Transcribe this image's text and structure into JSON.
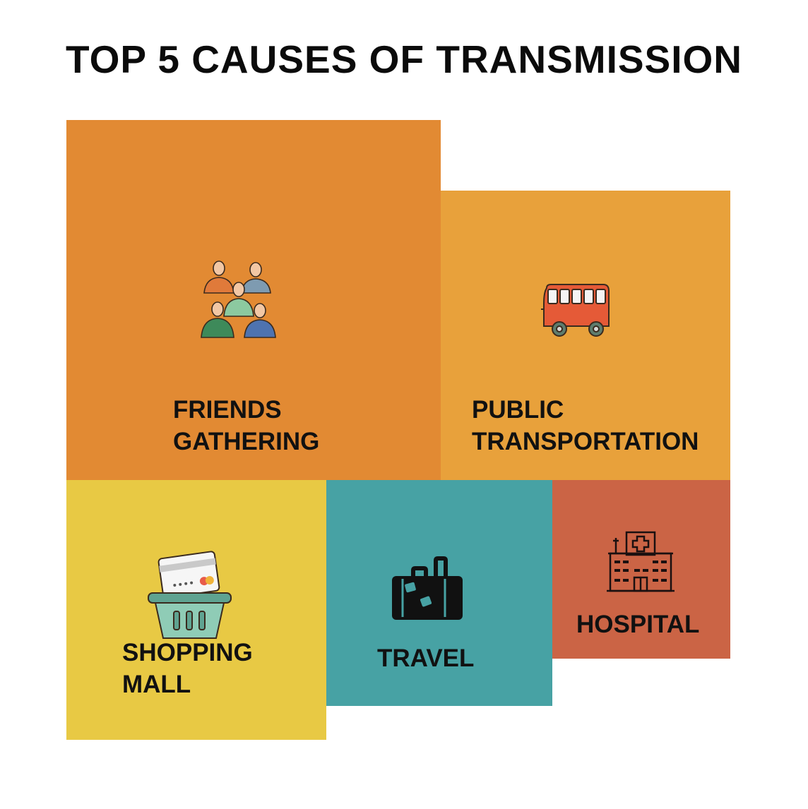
{
  "title": "TOP 5 CAUSES OF TRANSMISSION",
  "tiles": [
    {
      "id": "friends-gathering",
      "label_lines": [
        "FRIENDS",
        "GATHERING"
      ],
      "color": "#E28A33",
      "icon": "people-group-icon"
    },
    {
      "id": "public-transportation",
      "label_lines": [
        "PUBLIC",
        "TRANSPORTATION"
      ],
      "color": "#E8A13B",
      "icon": "bus-icon"
    },
    {
      "id": "shopping-mall",
      "label_lines": [
        "SHOPPING",
        "MALL"
      ],
      "color": "#E8C944",
      "icon": "shopping-basket-icon"
    },
    {
      "id": "travel",
      "label_lines": [
        "TRAVEL"
      ],
      "color": "#47A2A4",
      "icon": "suitcase-icon"
    },
    {
      "id": "hospital",
      "label_lines": [
        "HOSPITAL"
      ],
      "color": "#CB6445",
      "icon": "hospital-icon"
    }
  ]
}
